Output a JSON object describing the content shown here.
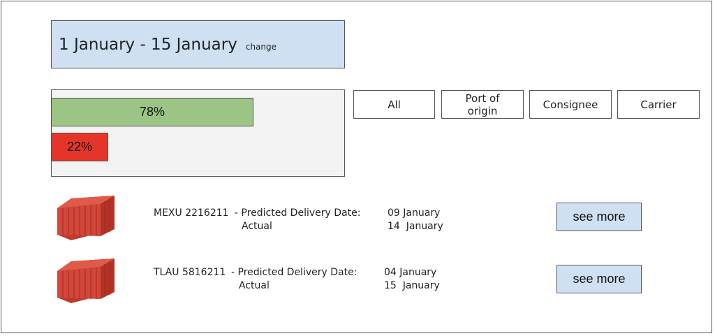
{
  "date_range": {
    "label": "1 January - 15 January",
    "change_link": "change"
  },
  "stats": {
    "bars": [
      {
        "label": "78%",
        "value": 78,
        "color": "#9cc485"
      },
      {
        "label": "22%",
        "value": 22,
        "color": "#e43528"
      }
    ]
  },
  "filters": [
    "All",
    "Port of origin",
    "Consignee",
    "Carrier"
  ],
  "shipments": [
    {
      "container_id": "MEXU 2216211",
      "predicted_label": "- Predicted Delivery Date:",
      "actual_label": "Actual",
      "predicted_date": "09 January",
      "actual_date": "14  January",
      "button": "see more"
    },
    {
      "container_id": "TLAU 5816211",
      "predicted_label": "- Predicted Delivery Date:",
      "actual_label": "Actual",
      "predicted_date": "04 January",
      "actual_date": "15  January",
      "button": "see more"
    }
  ],
  "icons": {
    "container": "shipping-container-icon"
  },
  "colors": {
    "date_box": "#cfe0f3",
    "green_bar": "#9cc485",
    "red_bar": "#e43528",
    "button": "#cfe0f3"
  }
}
